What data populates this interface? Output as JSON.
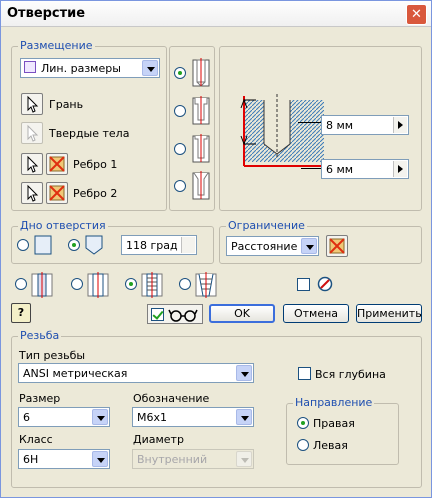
{
  "window": {
    "title": "Отверстие",
    "close": "✕"
  },
  "placement": {
    "label": "Размещение",
    "method": "Лин. размеры",
    "face": "Грань",
    "solids": "Твердые тела",
    "edge1": "Ребро 1",
    "edge2": "Ребро 2"
  },
  "preview": {
    "depth": "8 мм",
    "distance": "6 мм"
  },
  "bottom": {
    "label": "Дно отверстия",
    "angle": "118 град"
  },
  "termination": {
    "label": "Ограничение",
    "value": "Расстояние"
  },
  "buttons": {
    "ok": "OK",
    "cancel": "Отмена",
    "apply": "Применить",
    "help": "?"
  },
  "thread": {
    "label": "Резьба",
    "type_label": "Тип резьбы",
    "type": "ANSI метрическая",
    "full_depth": "Вся глубина",
    "size_label": "Размер",
    "size": "6",
    "designation_label": "Обозначение",
    "designation": "M6x1",
    "class_label": "Класс",
    "class": "6H",
    "diameter_label": "Диаметр",
    "diameter": "Внутренний"
  },
  "direction": {
    "label": "Направление",
    "right": "Правая",
    "left": "Левая"
  }
}
